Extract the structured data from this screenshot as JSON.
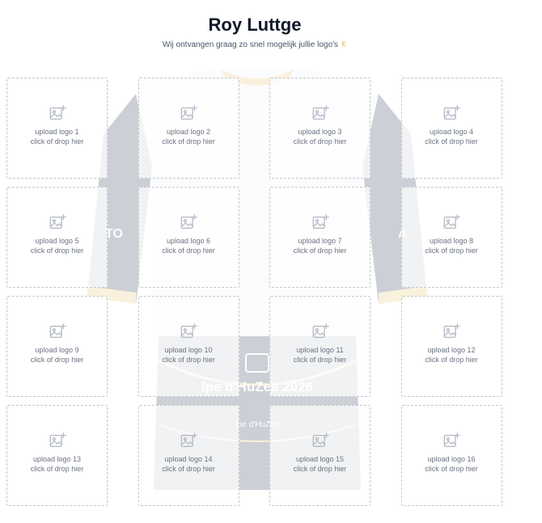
{
  "header": {
    "title": "Roy Luttge",
    "subtitle": "Wij ontvangen graag zo snel mogelijk jullie logo's",
    "subtitle_emoji": "✌"
  },
  "jersey": {
    "text_left": "TO",
    "text_right": "A",
    "event_name": "lpe d'HuZes 2026",
    "logo_text": "lpe d'HuZes"
  },
  "upload_slots": [
    {
      "label": "upload logo 1",
      "hint": "click of drop hier"
    },
    {
      "label": "upload logo 2",
      "hint": "click of drop hier"
    },
    {
      "label": "upload logo 3",
      "hint": "click of drop hier"
    },
    {
      "label": "upload logo 4",
      "hint": "click of drop hier"
    },
    {
      "label": "upload logo 5",
      "hint": "click of drop hier"
    },
    {
      "label": "upload logo 6",
      "hint": "click of drop hier"
    },
    {
      "label": "upload logo 7",
      "hint": "click of drop hier"
    },
    {
      "label": "upload logo 8",
      "hint": "click of drop hier"
    },
    {
      "label": "upload logo 9",
      "hint": "click of drop hier"
    },
    {
      "label": "upload logo 10",
      "hint": "click of drop hier"
    },
    {
      "label": "upload logo 11",
      "hint": "click of drop hier"
    },
    {
      "label": "upload logo 12",
      "hint": "click of drop hier"
    },
    {
      "label": "upload logo 13",
      "hint": "click of drop hier"
    },
    {
      "label": "upload logo 14",
      "hint": "click of drop hier"
    },
    {
      "label": "upload logo 15",
      "hint": "click of drop hier"
    },
    {
      "label": "upload logo 16",
      "hint": "click of drop hier"
    }
  ],
  "icons": {
    "slot_icon": "image-plus-icon"
  },
  "colors": {
    "jersey_navy": "#1e2b4a",
    "jersey_accent": "#e8c46a",
    "border": "#c4c7cc"
  }
}
